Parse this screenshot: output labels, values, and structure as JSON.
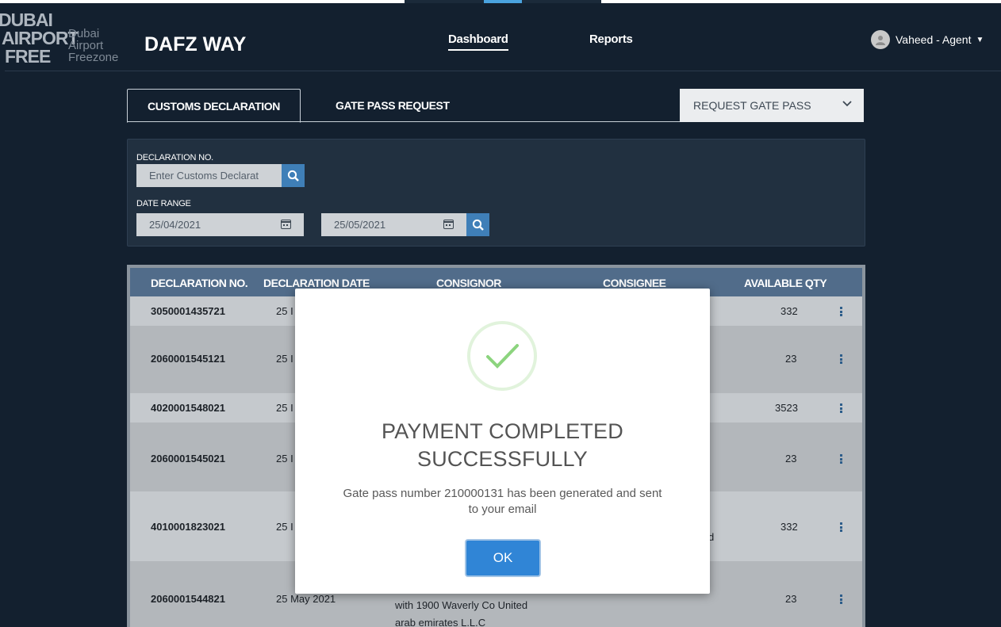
{
  "logo": {
    "lines": [
      "DUBAI",
      "AIRPORT",
      "FREE"
    ],
    "sub": [
      "Dubai",
      "Airport",
      "Freezone"
    ]
  },
  "brand": "DAFZ WAY",
  "nav": {
    "dashboard": "Dashboard",
    "reports": "Reports"
  },
  "user": {
    "name": "Vaheed - Agent"
  },
  "tabs": {
    "customs": "CUSTOMS DECLARATION",
    "gate_pass": "GATE PASS REQUEST"
  },
  "request_select": {
    "value": "REQUEST GATE PASS"
  },
  "filter": {
    "declaration_label": "DECLARATION NO.",
    "declaration_placeholder": "Enter Customs Declarat",
    "date_range_label": "DATE RANGE",
    "date_from": "25/04/2021",
    "date_to": "25/05/2021"
  },
  "table": {
    "headers": [
      "DECLARATION NO.",
      "DECLARATION DATE",
      "CONSIGNOR",
      "CONSIGNEE",
      "AVAILABLE QTY"
    ],
    "rows": [
      {
        "no": "3050001435721",
        "date": "25 I",
        "qty": "332"
      },
      {
        "no": "2060001545121",
        "date": "25 I",
        "qty": "23"
      },
      {
        "no": "4020001548021",
        "date": "25 I",
        "qty": "3523"
      },
      {
        "no": "2060001545021",
        "date": "25 I",
        "qty": "23"
      },
      {
        "no": "4010001823021",
        "date": "25 I",
        "qty": "332",
        "consignee_fragment": "d"
      },
      {
        "no": "2060001544821",
        "date": "25 May 2021",
        "qty": "23",
        "consignor_lines": [
          "with 1900 Waverly Co United",
          "arab emirates L.L.C"
        ]
      }
    ]
  },
  "modal": {
    "title_line1": "PAYMENT COMPLETED",
    "title_line2": "SUCCESSFULLY",
    "message_line1": "Gate pass number 210000131 has been generated and sent",
    "message_line2": "to your email",
    "ok_label": "OK"
  },
  "colors": {
    "background": "#13202f",
    "panel": "#213040",
    "table_header": "#516c8a",
    "primary_button": "#3085d6",
    "success": "#8cd47e"
  }
}
